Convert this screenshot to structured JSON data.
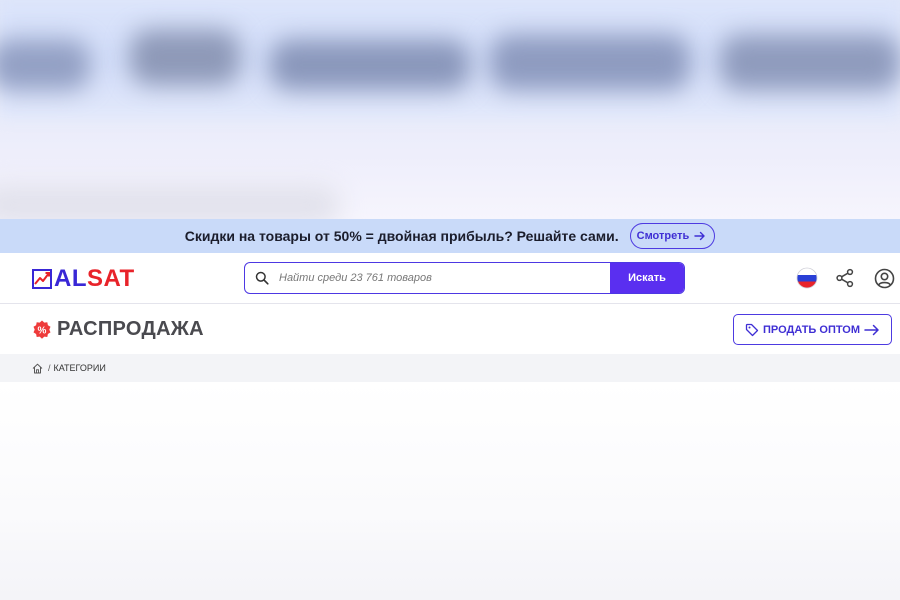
{
  "promo": {
    "text": "Скидки на товары от 50% = двойная прибыль? Решайте сами.",
    "button_label": "Смотреть"
  },
  "header": {
    "logo_part1": "AL",
    "logo_part2": "SAT",
    "search": {
      "placeholder": "Найти среди 23 761 товаров",
      "value": "",
      "button_label": "Искать"
    },
    "icons": [
      "flag-russia-icon",
      "share-icon",
      "user-icon"
    ]
  },
  "page": {
    "title": "РАСПРОДАЖА",
    "badge_symbol": "%",
    "sell_button_label": "ПРОДАТЬ ОПТОМ"
  },
  "breadcrumb": {
    "separator": "/",
    "items": [
      {
        "label": "КАТЕГОРИИ"
      }
    ]
  },
  "colors": {
    "brand_blue": "#3927d6",
    "brand_red": "#e8232a",
    "accent_purple": "#5a2ff0",
    "promo_bg": "#c9daf9"
  }
}
